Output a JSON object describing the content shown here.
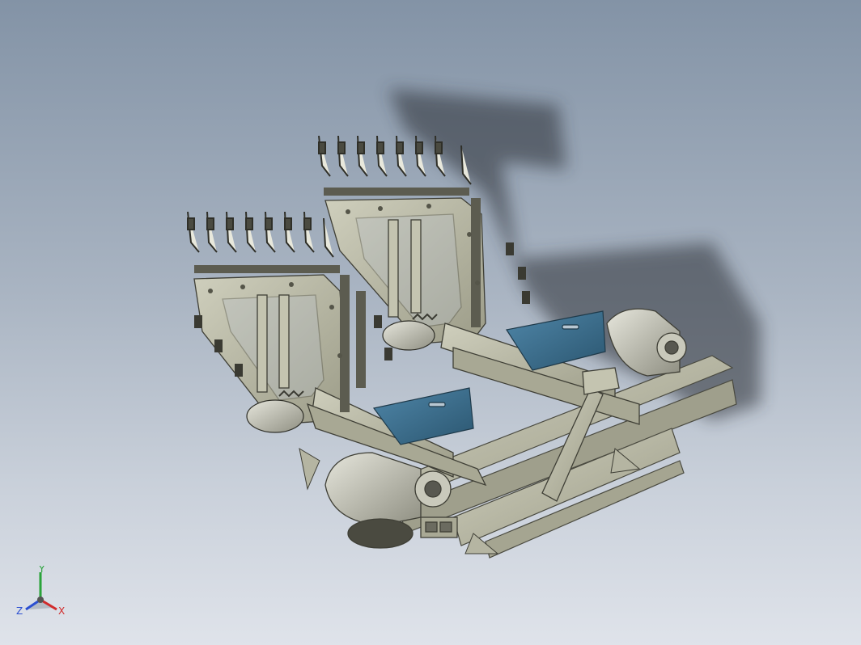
{
  "viewport": {
    "background_top": "#8393a6",
    "background_bottom": "#dfe3ea",
    "model_color": "#b8b8a4",
    "panel_color": "#3f6f8c"
  },
  "triad": {
    "x_label": "X",
    "y_label": "Y",
    "z_label": "Z",
    "x_color": "#d12b2b",
    "y_color": "#2aa33a",
    "z_color": "#2b4fd1"
  }
}
